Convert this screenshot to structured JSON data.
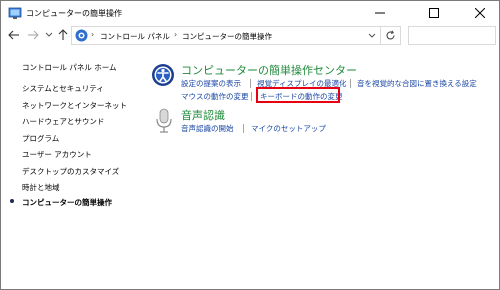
{
  "window": {
    "title": "コンピューターの簡単操作"
  },
  "address_bar": {
    "crumbs": [
      "コントロール パネル",
      "コンピューターの簡単操作"
    ]
  },
  "left_pane": {
    "home": "コントロール パネル ホーム",
    "items": [
      "システムとセキュリティ",
      "ネットワークとインターネット",
      "ハードウェアとサウンド",
      "プログラム",
      "ユーザー アカウント",
      "デスクトップのカスタマイズ",
      "時計と地域",
      "コンピューターの簡単操作"
    ]
  },
  "main": {
    "ease_center": {
      "title": "コンピューターの簡単操作センター",
      "links_row1": [
        "設定の提案の表示",
        "視覚ディスプレイの最適化",
        "音を視覚的な合図に置き換える設定"
      ],
      "links_row2": [
        "マウスの動作の変更",
        "キーボードの動作の変更"
      ],
      "icon": "ease-of-access-icon"
    },
    "speech": {
      "title": "音声認識",
      "links": [
        "音声認識の開始",
        "マイクのセットアップ"
      ],
      "icon": "microphone-icon"
    }
  },
  "highlight_color": "#e60012",
  "link_color": "#1a47a6",
  "section_title_color": "#1e8a3a"
}
